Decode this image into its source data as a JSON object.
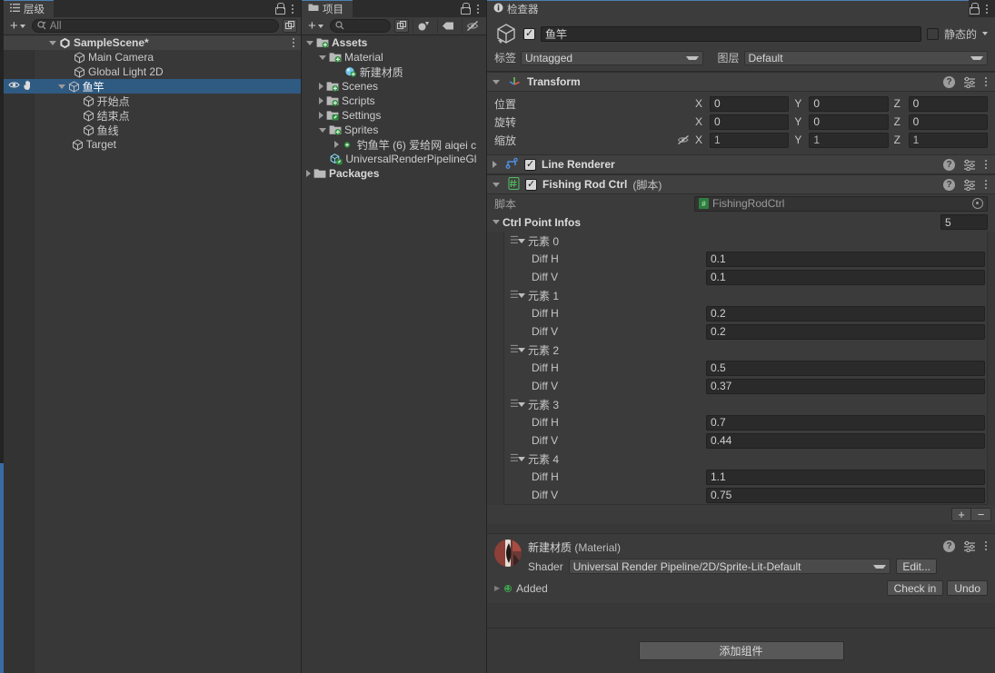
{
  "hierarchy": {
    "tab_label": "层级",
    "tab_icon": "hierarchy-icon",
    "toolbar": {
      "add_label": "+",
      "search_placeholder": "All",
      "search_value": ""
    },
    "rows": [
      {
        "label": "SampleScene*",
        "icon": "unity-scene-icon",
        "indent": 1,
        "expander": "down",
        "selected": false,
        "is_scene": true,
        "has_kebab": true
      },
      {
        "label": "Main Camera",
        "icon": "gameobject-cube-icon",
        "indent": 2,
        "expander": "none",
        "selected": false
      },
      {
        "label": "Global Light 2D",
        "icon": "gameobject-cube-icon",
        "indent": 2,
        "expander": "none",
        "selected": false
      },
      {
        "label": "鱼竿",
        "icon": "gameobject-cube-icon",
        "indent": 1.6,
        "expander": "down",
        "selected": true,
        "visibility": true
      },
      {
        "label": "开始点",
        "icon": "gameobject-cube-icon",
        "indent": 2.6,
        "expander": "none",
        "selected": false
      },
      {
        "label": "结束点",
        "icon": "gameobject-cube-icon",
        "indent": 2.6,
        "expander": "none",
        "selected": false
      },
      {
        "label": "鱼线",
        "icon": "gameobject-cube-icon",
        "indent": 2.6,
        "expander": "none",
        "selected": false
      },
      {
        "label": "Target",
        "icon": "gameobject-cube-icon",
        "indent": 1.85,
        "expander": "none",
        "selected": false
      }
    ]
  },
  "project": {
    "tab_label": "项目",
    "tab_icon": "folder-icon",
    "toolbar": {
      "add_label": "+",
      "search_placeholder": "",
      "search_value": ""
    },
    "rows": [
      {
        "label": "Assets",
        "icon": "folder-vcs-icon",
        "indent": 0,
        "expander": "down",
        "bold": true
      },
      {
        "label": "Material",
        "icon": "folder-vcs-icon",
        "indent": 1,
        "expander": "down",
        "bold": false
      },
      {
        "label": "新建材质",
        "icon": "material-sphere-icon",
        "indent": 2.2,
        "expander": "none",
        "bold": false
      },
      {
        "label": "Scenes",
        "icon": "folder-vcs-icon",
        "indent": 1,
        "expander": "right",
        "bold": false
      },
      {
        "label": "Scripts",
        "icon": "folder-vcs-icon",
        "indent": 1,
        "expander": "right",
        "bold": false
      },
      {
        "label": "Settings",
        "icon": "folder-vcs-edit-icon",
        "indent": 1,
        "expander": "right",
        "bold": false
      },
      {
        "label": "Sprites",
        "icon": "folder-vcs-icon",
        "indent": 1,
        "expander": "down",
        "bold": false
      },
      {
        "label": "钓鱼竿 (6) 爱给网 aiqei c",
        "icon": "sprite-asset-icon",
        "indent": 2.2,
        "expander": "right",
        "bold": false
      },
      {
        "label": "UniversalRenderPipelineGl",
        "icon": "prefab-vcs-icon",
        "indent": 1.1,
        "expander": "none",
        "bold": false
      },
      {
        "label": "Packages",
        "icon": "folder-plain-icon",
        "indent": 0,
        "expander": "right",
        "bold": true
      }
    ]
  },
  "inspector": {
    "tab_label": "检查器",
    "tab_icon": "info-icon",
    "object": {
      "enabled": true,
      "name": "鱼竿",
      "static_label": "静态的",
      "static_checked": false,
      "tag_label": "标签",
      "tag_value": "Untagged",
      "layer_label": "图层",
      "layer_value": "Default"
    },
    "transform": {
      "title": "Transform",
      "icon": "transform-axes-icon",
      "rows": [
        {
          "label": "位置",
          "x": "0",
          "y": "0",
          "z": "0",
          "dim": false,
          "link": false
        },
        {
          "label": "旋转",
          "x": "0",
          "y": "0",
          "z": "0",
          "dim": false,
          "link": false
        },
        {
          "label": "缩放",
          "x": "1",
          "y": "1",
          "z": "1",
          "dim": true,
          "link": true
        }
      ],
      "axis_x": "X",
      "axis_y": "Y",
      "axis_z": "Z"
    },
    "line_renderer": {
      "title": "Line Renderer",
      "enabled": true,
      "icon": "line-renderer-icon",
      "expander": "right"
    },
    "fishing_rod_ctrl": {
      "title": "Fishing Rod Ctrl",
      "subtitle": "(脚本)",
      "enabled": true,
      "icon": "csharp-script-icon",
      "script_label": "脚本",
      "script_value": "FishingRodCtrl",
      "array": {
        "title": "Ctrl Point Infos",
        "size": "5",
        "element_prefix": "元素",
        "field_h_label": "Diff H",
        "field_v_label": "Diff V",
        "elements": [
          {
            "name": "元素 0",
            "diff_h": "0.1",
            "diff_v": "0.1"
          },
          {
            "name": "元素 1",
            "diff_h": "0.2",
            "diff_v": "0.2"
          },
          {
            "name": "元素 2",
            "diff_h": "0.5",
            "diff_v": "0.37"
          },
          {
            "name": "元素 3",
            "diff_h": "0.7",
            "diff_v": "0.44"
          },
          {
            "name": "元素 4",
            "diff_h": "1.1",
            "diff_v": "0.75"
          }
        ],
        "add_label": "+",
        "remove_label": "−"
      }
    },
    "material": {
      "name": "新建材质",
      "type_suffix": "(Material)",
      "shader_label": "Shader",
      "shader_value": "Universal Render Pipeline/2D/Sprite-Lit-Default",
      "edit_label": "Edit...",
      "status": "Added",
      "checkin_label": "Check in",
      "undo_label": "Undo"
    },
    "add_component_label": "添加组件"
  }
}
